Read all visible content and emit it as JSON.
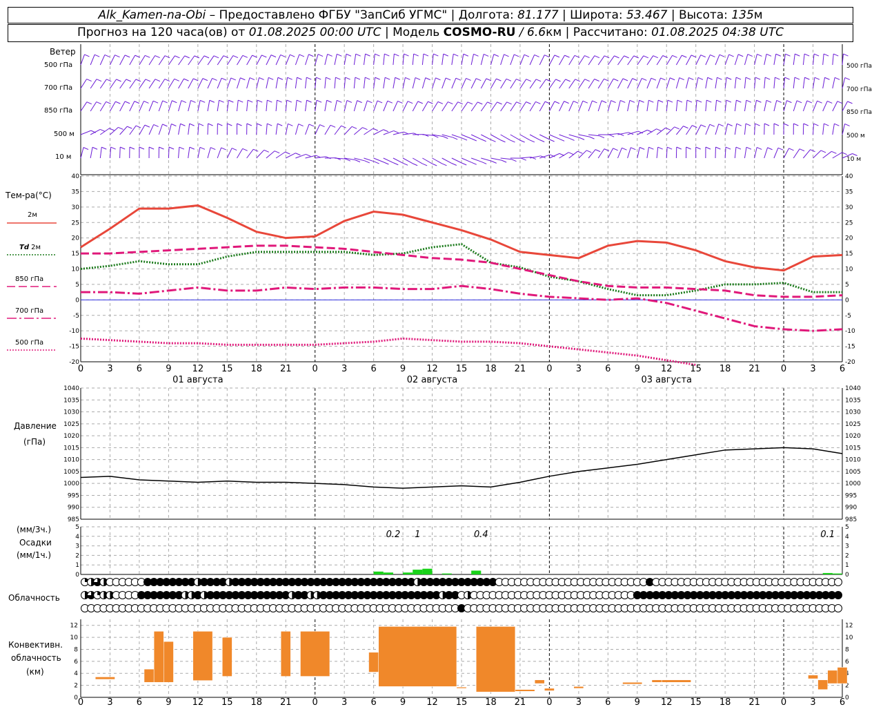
{
  "header": {
    "station": "Alk_Kamen-na-Obi",
    "provider": "– Предоставлено ФГБУ \"ЗапСиб УГМС\" | Долгота:",
    "lon": "81.177",
    "lat_label": "| Широта:",
    "lat": "53.467",
    "alt_label": "| Высота:",
    "alt": "135",
    "alt_unit": "м",
    "line2_a": "Прогноз на 120 часа(ов) от",
    "run": "01.08.2025 00:00 UTC",
    "line2_b": "| Модель",
    "model": "COSMO-RU",
    "res": "/ 6.6",
    "res_unit": "км",
    "calc_label": "| Рассчитано:",
    "calc": "01.08.2025 04:38 UTC"
  },
  "labels": {
    "wind": "Ветер",
    "levels": [
      "500 гПа",
      "700 гПа",
      "850 гПа",
      "500 м",
      "10  м"
    ],
    "temp": "Тем-ра(°C)",
    "t2m": "2м",
    "td": "Td",
    "td2m": "2м",
    "t850": "850 гПа",
    "t700": "700 гПа",
    "t500": "500 гПа",
    "pressure": "Давление",
    "pressure_unit": "(гПа)",
    "precip_unit3": "(мм/3ч.)",
    "precip": "Осадки",
    "precip_unit1": "(мм/1ч.)",
    "cloud": "Облачность",
    "conv1": "Конвективн.",
    "conv2": "облачность",
    "conv3": "(км)"
  },
  "days": [
    "01 августа",
    "02 августа",
    "03 августа"
  ],
  "x_ticks": [
    "0",
    "3",
    "6",
    "9",
    "12",
    "15",
    "18",
    "21",
    "0",
    "3",
    "6",
    "9",
    "12",
    "15",
    "18",
    "21",
    "0",
    "3",
    "6",
    "9",
    "12",
    "15",
    "18",
    "21",
    "0",
    "3",
    "6"
  ],
  "colors": {
    "t2m": "#e8473a",
    "td": "#1a7a1a",
    "t850": "#e0187a",
    "t700": "#e0187a",
    "t500": "#e0187a",
    "wind": "#6a1ad6",
    "pressure": "#000000",
    "precip": "#19d219",
    "conv": "#f0882a",
    "zero": "#3030e0"
  },
  "chart_data": [
    {
      "type": "line",
      "title": "Тем-ра(°C)",
      "x_hours": [
        0,
        3,
        6,
        9,
        12,
        15,
        18,
        21,
        24,
        27,
        30,
        33,
        36,
        39,
        42,
        45,
        48,
        51,
        54,
        57,
        60,
        63,
        66,
        69,
        72,
        75,
        78
      ],
      "ylim": [
        -20,
        40
      ],
      "series": [
        {
          "name": "2м",
          "style": "solid",
          "values": [
            17,
            23,
            29.5,
            29.5,
            30.5,
            26.5,
            22,
            20,
            20.5,
            25.5,
            28.5,
            27.5,
            25,
            22.5,
            19.5,
            15.5,
            14.5,
            13.5,
            17.5,
            19,
            18.5,
            16,
            12.5,
            10.5,
            9.5,
            14,
            14.5
          ]
        },
        {
          "name": "Td 2м",
          "style": "dotted",
          "values": [
            10,
            11,
            12.5,
            11.5,
            11.5,
            14,
            15.5,
            15.5,
            15.5,
            15.5,
            14.5,
            15,
            17,
            18,
            12,
            10.5,
            7.5,
            6,
            3.5,
            1.5,
            1.5,
            3,
            5,
            5,
            5.5,
            2.5,
            2.5
          ]
        },
        {
          "name": "850 гПа",
          "style": "dashed",
          "values": [
            15,
            15,
            15.5,
            16,
            16.5,
            17,
            17.5,
            17.5,
            17,
            16.5,
            15.5,
            14.5,
            13.5,
            13,
            12,
            10,
            8,
            6,
            4.5,
            4,
            4,
            3.5,
            3,
            1.5,
            1,
            1,
            1.5
          ]
        },
        {
          "name": "700 гПа",
          "style": "dashdot",
          "values": [
            2.5,
            2.5,
            2,
            3,
            4,
            3,
            3,
            4,
            3.5,
            4,
            4,
            3.5,
            3.5,
            4.5,
            3.5,
            2,
            1,
            0.5,
            0,
            0.5,
            -1,
            -3.5,
            -6,
            -8.5,
            -9.5,
            -10,
            -9.5
          ]
        },
        {
          "name": "500 гПа",
          "style": "dotted",
          "values": [
            -12.5,
            -13,
            -13.5,
            -14,
            -14,
            -14.5,
            -14.5,
            -14.5,
            -14.5,
            -14,
            -13.5,
            -12.5,
            -13,
            -13.5,
            -13.5,
            -14,
            -15,
            -16,
            -17,
            -18,
            -19.5,
            -21
          ]
        }
      ]
    },
    {
      "type": "line",
      "title": "Давление (гПа)",
      "x_hours": [
        0,
        3,
        6,
        9,
        12,
        15,
        18,
        21,
        24,
        27,
        30,
        33,
        36,
        39,
        42,
        45,
        48,
        51,
        54,
        57,
        60,
        63,
        66,
        69,
        72,
        75,
        78
      ],
      "ylim": [
        985,
        1040
      ],
      "series": [
        {
          "name": "Давление",
          "values": [
            1002.5,
            1003,
            1001.5,
            1001,
            1000.5,
            1001,
            1000.5,
            1000.5,
            1000,
            999.5,
            998.5,
            998,
            998.5,
            999,
            998.5,
            1000.5,
            1003,
            1005,
            1006.5,
            1008,
            1010,
            1012,
            1014,
            1014.5,
            1015,
            1014.5,
            1012.5
          ]
        }
      ]
    },
    {
      "type": "bar",
      "title": "Осадки",
      "annotations": [
        {
          "hour": 32,
          "label": "0.2"
        },
        {
          "hour": 34.5,
          "label": "1"
        },
        {
          "hour": 41,
          "label": "0.4"
        },
        {
          "hour": 76.5,
          "label": "0.1"
        }
      ],
      "ylim": [
        0,
        5
      ],
      "bars": [
        [
          30,
          31,
          0.3
        ],
        [
          31,
          32,
          0.2
        ],
        [
          33,
          34,
          0.2
        ],
        [
          34,
          35,
          0.5
        ],
        [
          35,
          36,
          0.6
        ],
        [
          37,
          38,
          0.1
        ],
        [
          40,
          41,
          0.4
        ],
        [
          76,
          77,
          0.15
        ],
        [
          77,
          78,
          0.1
        ]
      ]
    },
    {
      "type": "bar",
      "title": "Конвективн. облачность (км)",
      "ylim": [
        0,
        13
      ],
      "bars": [
        [
          1.5,
          3.5,
          3,
          3.4
        ],
        [
          6.5,
          7.5,
          2.5,
          4.7
        ],
        [
          7.5,
          8.5,
          2.5,
          11
        ],
        [
          8.5,
          9.5,
          2.5,
          9.3
        ],
        [
          11.5,
          13.5,
          2.8,
          11
        ],
        [
          14.5,
          15.5,
          3.5,
          10
        ],
        [
          20.5,
          21.5,
          3.5,
          11
        ],
        [
          22.5,
          25.5,
          3.5,
          11
        ],
        [
          29.5,
          30.5,
          4.2,
          7.5
        ],
        [
          30.5,
          38.5,
          1.8,
          11.8
        ],
        [
          38.5,
          39.5,
          1.5,
          1.7
        ],
        [
          40.5,
          44.5,
          0.9,
          11.8
        ],
        [
          44.5,
          46.5,
          1,
          1.3
        ],
        [
          46.5,
          47.5,
          2.3,
          2.9
        ],
        [
          47.5,
          48.5,
          1.1,
          1.5
        ],
        [
          50.5,
          51.5,
          1.5,
          1.8
        ],
        [
          55.5,
          57.5,
          2.2,
          2.5
        ],
        [
          58.5,
          59.5,
          2.5,
          2.9
        ],
        [
          59.5,
          62.5,
          2.5,
          2.9
        ],
        [
          74.5,
          75.5,
          3.1,
          3.7
        ],
        [
          75.5,
          76.5,
          1.3,
          2.9
        ],
        [
          76.5,
          77.5,
          2.3,
          4.5
        ],
        [
          77.5,
          78.5,
          2.3,
          5
        ]
      ]
    },
    {
      "type": "table",
      "title": "Облачность",
      "rows": [
        "1234000000888888884888848888888888888888888888888888848888888888880000000000000000000000008000000000000000000000000000000",
        "4314400008888888448488888888888884884488888888888888888884880400000000000000000000000000888888888888888888888888888888888",
        "0000000000000000000000000000000000000000000000000000000000008000000000000000000000000000000000000000000000000000000000000"
      ]
    }
  ]
}
